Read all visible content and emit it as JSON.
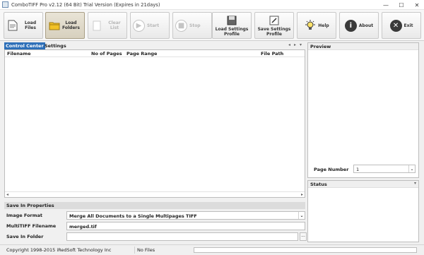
{
  "window": {
    "title": "ComboTIFF Pro v2.12 (64 Bit)  Trial Version (Expires in 21days)",
    "minimize": "—",
    "maximize": "☐",
    "close": "✕"
  },
  "toolbar": {
    "load_files": "Load Files",
    "load_folders_1": "Load",
    "load_folders_2": "Folders",
    "clear_list": "Clear List",
    "start": "Start",
    "stop": "Stop",
    "load_profile_1": "Load Settings",
    "load_profile_2": "Profile",
    "save_profile_1": "Save Settings",
    "save_profile_2": "Profile",
    "help": "Help",
    "about": "About",
    "exit": "Exit"
  },
  "tabs": [
    "Control Center",
    "Settings"
  ],
  "tab_nav": {
    "prev": "◂",
    "next": "▸",
    "menu": "▾"
  },
  "grid": {
    "columns": [
      "Filename",
      "No of Pages",
      "Page Range",
      "File Path"
    ],
    "rows": []
  },
  "properties": {
    "title": "Save In Properties",
    "image_format_label": "Image Format",
    "image_format_value": "Merge All Documents to a Single Multipages TIFF",
    "multitiff_label": "MultiTIFF Filename",
    "multitiff_value": "merged.tif",
    "save_folder_label": "Save In Folder",
    "save_folder_value": "",
    "browse": "..."
  },
  "preview": {
    "title": "Preview",
    "page_number_label": "Page Number",
    "page_number_value": "1"
  },
  "status_pane": {
    "title": "Status"
  },
  "statusbar": {
    "copyright": "Copyright 1998-2015 iRedSoft Technology Inc",
    "files": "No Files",
    "progress": 0.0
  },
  "colors": {
    "tab_active": "#2d6fb8",
    "progress": "#3c9e3c"
  }
}
